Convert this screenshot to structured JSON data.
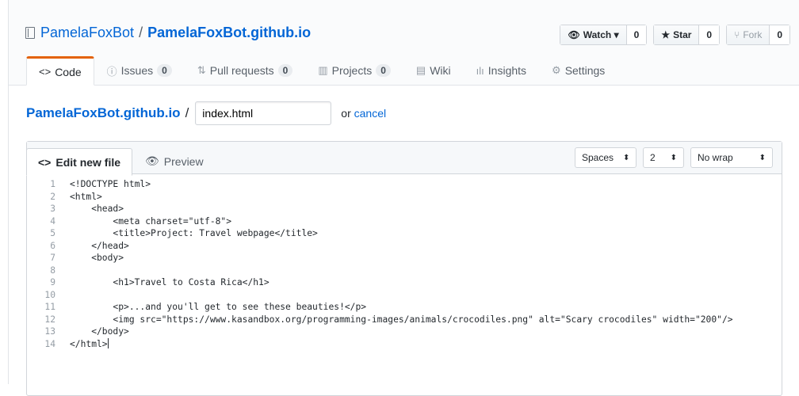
{
  "repo": {
    "owner": "PamelaFoxBot",
    "separator": "/",
    "name": "PamelaFoxBot.github.io"
  },
  "actions": {
    "watch_label": "Watch ▾",
    "watch_count": "0",
    "star_label": "Star",
    "star_count": "0",
    "fork_label": "Fork",
    "fork_count": "0"
  },
  "tabs": [
    {
      "label": "Code",
      "icon": "code-icon"
    },
    {
      "label": "Issues",
      "count": "0",
      "icon": "issue-icon"
    },
    {
      "label": "Pull requests",
      "count": "0",
      "icon": "pull-request-icon"
    },
    {
      "label": "Projects",
      "count": "0",
      "icon": "project-icon"
    },
    {
      "label": "Wiki",
      "icon": "wiki-icon"
    },
    {
      "label": "Insights",
      "icon": "graph-icon"
    },
    {
      "label": "Settings",
      "icon": "gear-icon"
    }
  ],
  "filebar": {
    "repo": "PamelaFoxBot.github.io",
    "slash": "/",
    "filename": "index.html",
    "or": "or",
    "cancel": "cancel"
  },
  "editor": {
    "tab_edit": "Edit new file",
    "tab_preview": "Preview",
    "indent_mode": "Spaces",
    "indent_size": "2",
    "wrap_mode": "No wrap",
    "lines": [
      "<!DOCTYPE html>",
      "<html>",
      "    <head>",
      "        <meta charset=\"utf-8\">",
      "        <title>Project: Travel webpage</title>",
      "    </head>",
      "    <body>",
      "",
      "        <h1>Travel to Costa Rica</h1>",
      "",
      "        <p>...and you'll get to see these beauties!</p>",
      "        <img src=\"https://www.kasandbox.org/programming-images/animals/crocodiles.png\" alt=\"Scary crocodiles\" width=\"200\"/>",
      "    </body>",
      "</html>"
    ]
  }
}
